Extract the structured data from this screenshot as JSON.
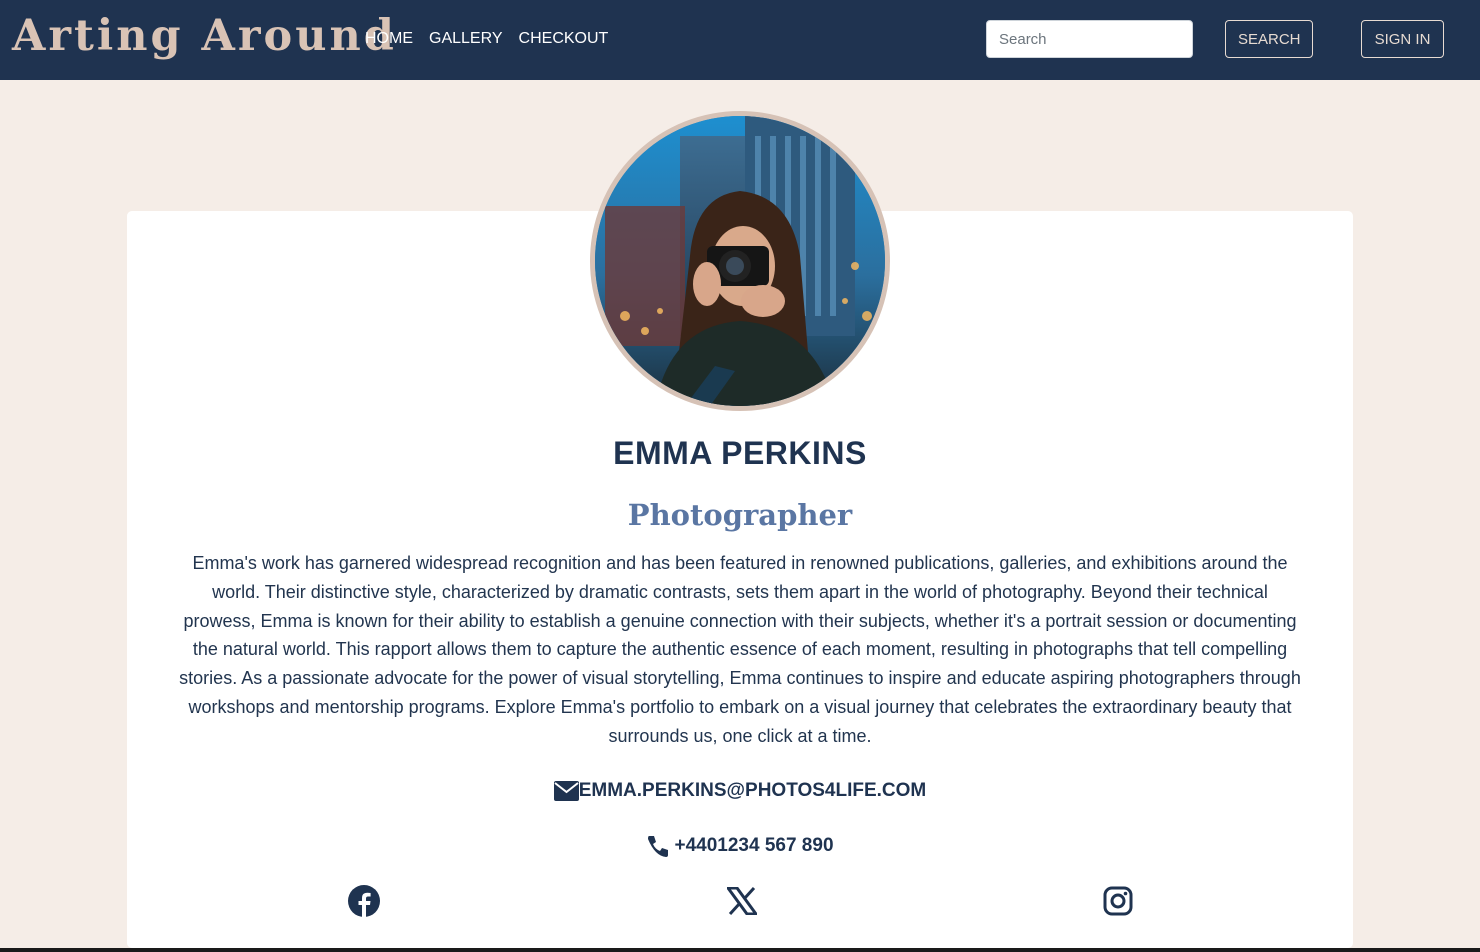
{
  "navbar": {
    "brand": "Arting Around",
    "links": [
      {
        "label": "HOME"
      },
      {
        "label": "GALLERY"
      },
      {
        "label": "CHECKOUT"
      }
    ],
    "search": {
      "placeholder": "Search"
    },
    "search_button": "SEARCH",
    "signin_button": "SIGN IN"
  },
  "profile": {
    "name": "EMMA PERKINS",
    "role": "Photographer",
    "bio": "Emma's work has garnered widespread recognition and has been featured in renowned publications, galleries, and exhibitions around the world. Their distinctive style, characterized by dramatic contrasts, sets them apart in the world of photography. Beyond their technical prowess, Emma is known for their ability to establish a genuine connection with their subjects, whether it's a portrait session or documenting the natural world. This rapport allows them to capture the authentic essence of each moment, resulting in photographs that tell compelling stories. As a passionate advocate for the power of visual storytelling, Emma continues to inspire and educate aspiring photographers through workshops and mentorship programs. Explore Emma's portfolio to embark on a visual journey that celebrates the extraordinary beauty that surrounds us, one click at a time.",
    "email": "EMMA.PERKINS@PHOTOS4LIFE.COM",
    "phone": "+4401234 567 890"
  },
  "social": [
    {
      "icon": "facebook-icon"
    },
    {
      "icon": "x-twitter-icon"
    },
    {
      "icon": "instagram-icon"
    }
  ],
  "colors": {
    "navbar": "#1f3350",
    "page_background": "#f5ede7",
    "brand": "#d9c3b5",
    "role": "#5a76a3",
    "avatar_border": "#d6c2b6"
  },
  "icons": {
    "email": "envelope-icon",
    "phone": "phone-icon"
  }
}
